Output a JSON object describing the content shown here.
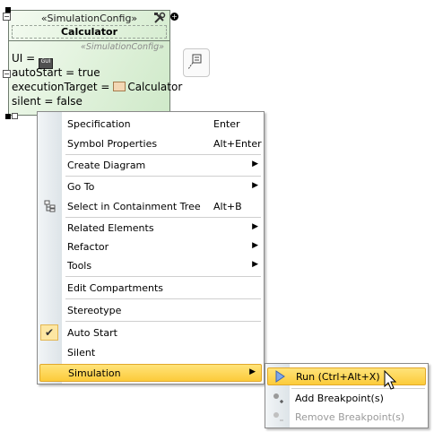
{
  "diagram": {
    "stereotype_header": "«SimulationConfig»",
    "name": "Calculator",
    "stereotype_inner": "«SimulationConfig»",
    "properties": {
      "ui_label": "UI =",
      "gui_badge": "GUI",
      "auto_start": "autoStart = true",
      "execution_target_label": "executionTarget =",
      "execution_target_value": "Calculator",
      "silent": "silent = false"
    },
    "collapse_symbol": "−"
  },
  "menu": {
    "items": [
      {
        "label": "Specification",
        "accel": "Enter"
      },
      {
        "label": "Symbol Properties",
        "accel": "Alt+Enter"
      },
      {
        "label": "Create Diagram"
      },
      {
        "label": "Go To"
      },
      {
        "label": "Select in Containment Tree",
        "accel": "Alt+B"
      },
      {
        "label": "Related Elements"
      },
      {
        "label": "Refactor"
      },
      {
        "label": "Tools"
      },
      {
        "label": "Edit Compartments"
      },
      {
        "label": "Stereotype"
      },
      {
        "label": "Auto Start"
      },
      {
        "label": "Silent"
      },
      {
        "label": "Simulation"
      }
    ],
    "submenu_arrow": "▶",
    "check_mark": "✔"
  },
  "submenu": {
    "items": [
      {
        "label": "Run (Ctrl+Alt+X)"
      },
      {
        "label": "Add Breakpoint(s)"
      },
      {
        "label": "Remove Breakpoint(s)"
      }
    ]
  },
  "colors": {
    "highlight": "#fccb3a",
    "node_fill": "#dff1da"
  },
  "icons": {
    "tools": "tools-icon",
    "add": "plus-icon",
    "note": "note-icon",
    "tree": "containment-tree-icon",
    "run": "run-icon",
    "add_breakpoint": "add-breakpoint-icon",
    "remove_breakpoint": "remove-breakpoint-icon"
  }
}
